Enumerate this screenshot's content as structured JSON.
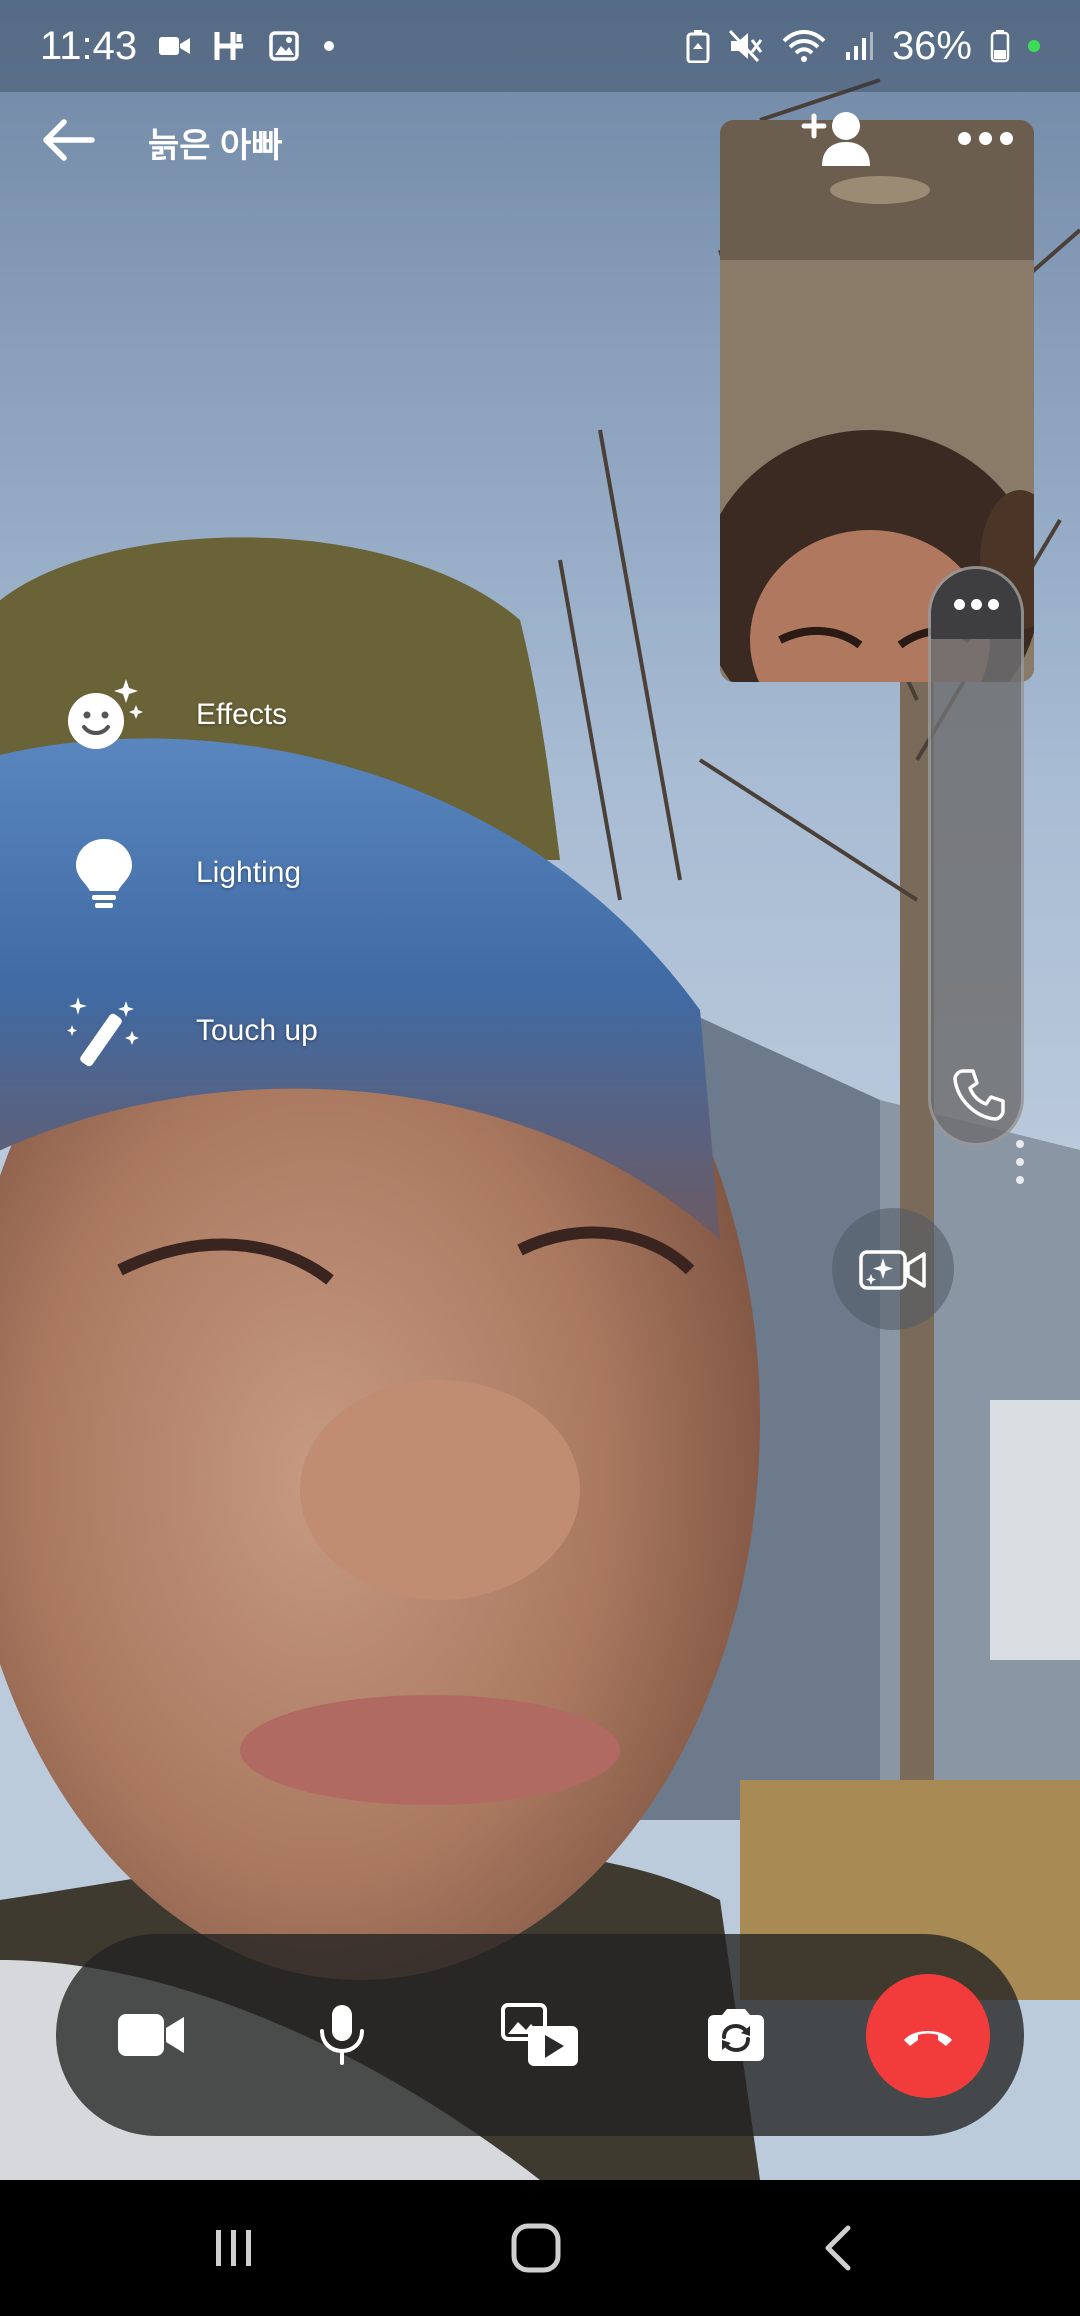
{
  "status_bar": {
    "time": "11:43",
    "battery": "36%",
    "icons": [
      "video-record-icon",
      "h-icon",
      "gallery-icon",
      "dot-icon",
      "battery-saver-icon",
      "mute-icon",
      "wifi-icon",
      "signal-icon",
      "battery-icon"
    ]
  },
  "call": {
    "title": "늙은 아빠"
  },
  "effects_menu": {
    "items": [
      {
        "label": "Effects",
        "icon": "smiley-sparkle-icon"
      },
      {
        "label": "Lighting",
        "icon": "lightbulb-icon"
      },
      {
        "label": "Touch up",
        "icon": "magic-wand-icon"
      }
    ]
  },
  "controls": {
    "items": [
      "camera-icon",
      "microphone-icon",
      "share-media-icon",
      "flip-camera-icon",
      "end-call-icon"
    ]
  },
  "nav_bar": {
    "items": [
      "recent-apps-icon",
      "home-icon",
      "back-icon"
    ]
  },
  "colors": {
    "end_call": "#f23b3b",
    "control_bar": "#232323",
    "status_battery_dot": "#3ddc55"
  }
}
